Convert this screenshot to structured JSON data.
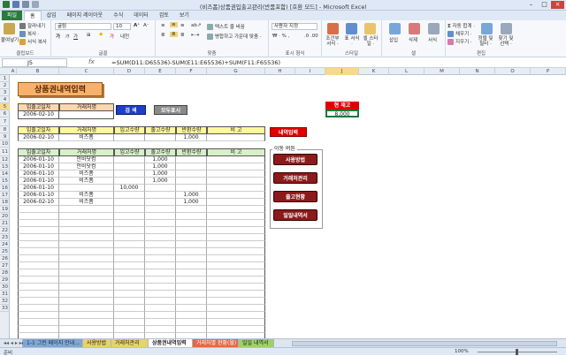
{
  "window": {
    "title": "(비즈폼)상품권입출고관리(반품포함) [호환 모드] - Microsoft Excel",
    "controls": [
      "–",
      "□",
      "×"
    ]
  },
  "ribbon_tabs": [
    "파일",
    "홈",
    "삽입",
    "페이지 레이아웃",
    "수식",
    "데이터",
    "검토",
    "보기"
  ],
  "ribbon": {
    "clipboard": {
      "paste": "붙여넣기",
      "cut": "잘라내기",
      "copy": "복사 ·",
      "format_painter": "서식 복사",
      "label": "클립보드"
    },
    "font": {
      "name": "굴림",
      "size": "10",
      "label": "글꼴"
    },
    "alignment": {
      "wrap": "텍스트 줄 바꿈",
      "merge": "병합하고 가운데 맞춤 ·",
      "label": "맞춤"
    },
    "number": {
      "format": "사용자 지정",
      "label": "표시 형식"
    },
    "styles": {
      "conditional": "조건부 서식 ·",
      "table": "표 서식 ·",
      "cell": "셀 스타일 ·",
      "label": "스타일"
    },
    "cells": {
      "insert": "삽입",
      "delete": "삭제",
      "format": "서식",
      "label": "셀"
    },
    "editing": {
      "autosum": "자동 합계 ·",
      "fill": "채우기 ·",
      "clear": "지우기 ·",
      "sort": "정렬 및 필터 ·",
      "find": "찾기 및 선택 ·",
      "label": "편집"
    }
  },
  "formula_bar": {
    "name_box": "J5",
    "fx": "fx",
    "formula": "=SUM(D11:D65536)-SUM(E11:E65536)+SUM(F11:F65536)"
  },
  "columns": [
    "A",
    "B",
    "C",
    "D",
    "E",
    "F",
    "G",
    "H",
    "I",
    "J",
    "K",
    "L",
    "M",
    "N",
    "O",
    "P"
  ],
  "rows": [
    "1",
    "2",
    "3",
    "4",
    "5",
    "6",
    "7",
    "8",
    "9",
    "10",
    "11",
    "12",
    "13",
    "14",
    "15",
    "16",
    "17",
    "18",
    "19",
    "20",
    "21",
    "22",
    "23",
    "24",
    "25",
    "26",
    "27",
    "28",
    "29",
    "30",
    "31",
    "32",
    "33"
  ],
  "sheet": {
    "title": "상품권내역입력",
    "search_headers": [
      "입출고일자",
      "거래처명"
    ],
    "search_values": [
      "2006-02-10",
      ""
    ],
    "search_button": "검 색",
    "show_all_button": "모두표시",
    "stock_label": "현 재고",
    "stock_value": "8,000",
    "result_headers": [
      "입출고일자",
      "거래처명",
      "입고수량",
      "출고수량",
      "반환수량",
      "비 고"
    ],
    "result_row": [
      "2006-02-10",
      "비즈폼",
      "",
      "",
      "1,000",
      ""
    ],
    "entry_button": "내역입력",
    "main_headers": [
      "입출고일자",
      "거래처명",
      "입고수량",
      "출고수량",
      "반환수량",
      "비 고"
    ],
    "main_rows": [
      [
        "2006-01-10",
        "안비닷컴",
        "",
        "1,000",
        "",
        ""
      ],
      [
        "2006-01-10",
        "안비닷컴",
        "",
        "1,000",
        "",
        ""
      ],
      [
        "2006-01-10",
        "비즈폼",
        "",
        "1,000",
        "",
        ""
      ],
      [
        "2006-01-10",
        "비즈폼",
        "",
        "1,000",
        "",
        ""
      ],
      [
        "2006-01-10",
        "",
        "10,000",
        "",
        "",
        ""
      ],
      [
        "2006-01-10",
        "비즈폼",
        "",
        "",
        "1,000",
        ""
      ],
      [
        "2006-02-10",
        "비즈폼",
        "",
        "",
        "1,000",
        ""
      ]
    ],
    "nav_group_label": "이동 버튼",
    "nav_buttons": [
      "사용방법",
      "거래처관리",
      "출고현황",
      "일일내역서"
    ]
  },
  "sheet_tabs": [
    "1-1 그린 페이지 안내...",
    "사용방법",
    "거래처관리",
    "상품권내역입력",
    "거래처별 현황(월)",
    "일일 내역서"
  ],
  "active_sheet_index": 3,
  "status": {
    "ready": "준비",
    "zoom": "100%"
  },
  "colors": {
    "excel_green": "#2a7a3b",
    "title_orange": "#f6b26b",
    "search_blue": "#1f3fc8",
    "stock_red": "#e00000",
    "nav_dark_red": "#8b1a1a"
  }
}
